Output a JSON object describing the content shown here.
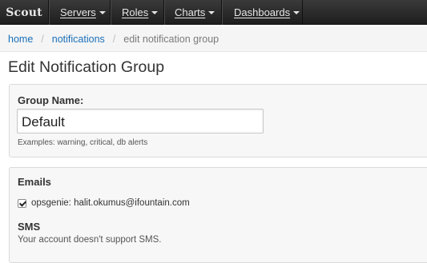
{
  "navbar": {
    "brand": "Scout",
    "items": [
      {
        "label": "Servers"
      },
      {
        "label": "Roles"
      },
      {
        "label": "Charts"
      },
      {
        "label": "Dashboards"
      }
    ]
  },
  "breadcrumb": {
    "home": "home",
    "notifications": "notifications",
    "current": "edit notification group",
    "separator": "/"
  },
  "page": {
    "title": "Edit Notification Group"
  },
  "group_form": {
    "name_label": "Group Name:",
    "name_value": "Default",
    "help": "Examples: warning, critical, db alerts"
  },
  "notify": {
    "emails_label": "Emails",
    "email_entry": "opsgenie: halit.okumus@ifountain.com",
    "email_checked": true,
    "sms_label": "SMS",
    "sms_note": "Your account doesn't support SMS."
  }
}
